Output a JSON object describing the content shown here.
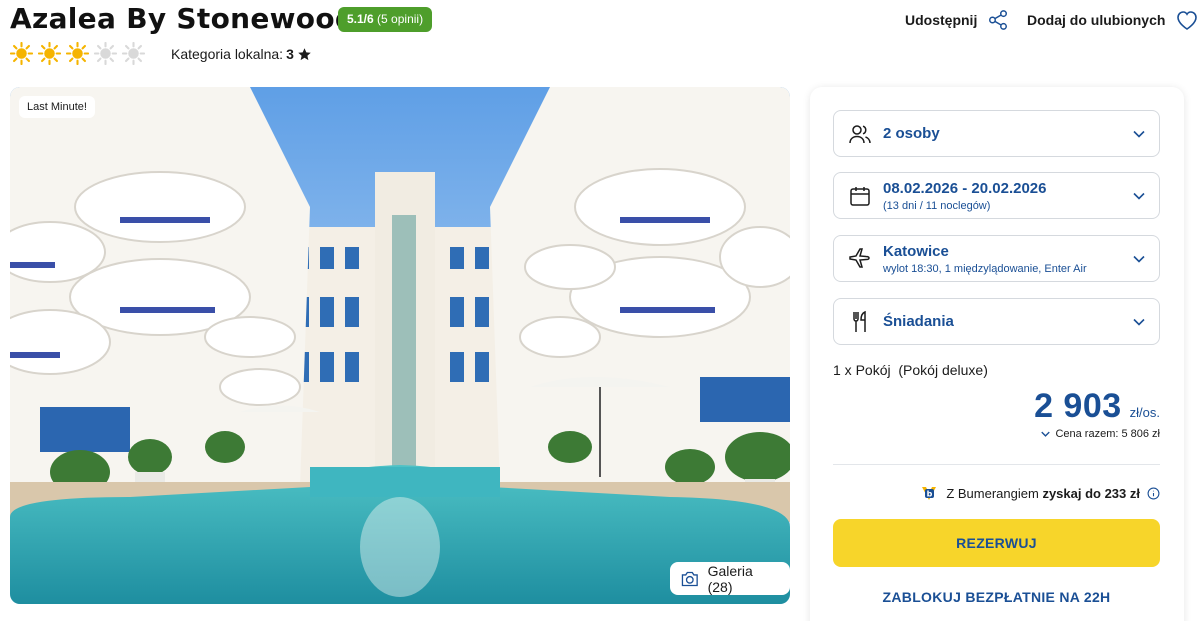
{
  "hotel": {
    "name": "Azalea By Stonewood",
    "rating_score": "5.1/6",
    "rating_opinions": "(5 opinii)",
    "suns_filled": 3,
    "suns_total": 5,
    "category_label": "Kategoria lokalna:",
    "category_value": "3"
  },
  "actions": {
    "share_label": "Udostępnij",
    "favorite_label": "Dodaj do ulubionych"
  },
  "gallery": {
    "badge": "Last Minute!",
    "button_label": "Galeria (28)"
  },
  "booking": {
    "persons": {
      "label": "2 osoby",
      "icon": "people-icon"
    },
    "dates": {
      "label": "08.02.2026 - 20.02.2026",
      "sub": "(13 dni / 11 noclegów)",
      "icon": "calendar-icon"
    },
    "flight": {
      "label": "Katowice",
      "sub": "wylot 18:30, 1 międzylądowanie, Enter Air",
      "icon": "plane-icon"
    },
    "board": {
      "label": "Śniadania",
      "icon": "fork-knife-icon"
    },
    "room_qty": "1 x Pokój",
    "room_type": "(Pokój deluxe)",
    "price": "2 903",
    "price_unit": "zł/os.",
    "total_label": "Cena razem: 5 806 zł",
    "boomerang_prefix": "Z Bumerangiem",
    "boomerang_bold": "zyskaj do 233 zł",
    "reserve_label": "REZERWUJ",
    "block_label": "ZABLOKUJ BEZPŁATNIE NA 22H"
  },
  "colors": {
    "brand_blue": "#1a4f95",
    "rating_green": "#4e9e2b",
    "cta_yellow": "#f7d52a",
    "sun_yellow": "#f5b400",
    "sun_grey": "#d9d9d9"
  }
}
